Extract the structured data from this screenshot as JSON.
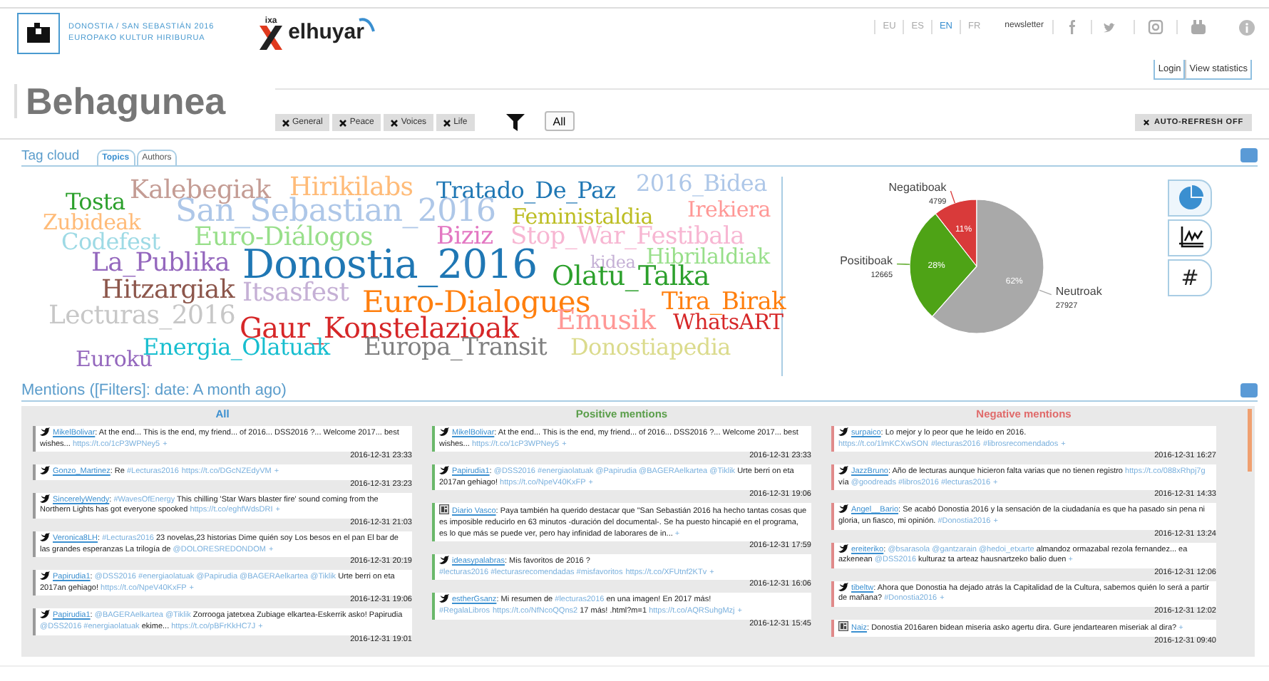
{
  "header": {
    "logo_lines": [
      "DONOSTIA / SAN SEBASTIÁN 2016",
      "EUROPAKO KULTUR HIRIBURUA"
    ],
    "partner_small": "ixa",
    "partner_name": "elhuyar",
    "languages": [
      {
        "label": "EU",
        "selected": false
      },
      {
        "label": "ES",
        "selected": false
      },
      {
        "label": "EN",
        "selected": true
      },
      {
        "label": "FR",
        "selected": false
      }
    ],
    "newsletter": "newsletter",
    "login": "Login",
    "view_statistics": "View statistics"
  },
  "title": "Behagunea",
  "filters": [
    "General",
    "Peace",
    "Voices",
    "Life"
  ],
  "all_button": "All",
  "auto_refresh": "AUTO-REFRESH OFF",
  "tag_cloud": {
    "title": "Tag cloud",
    "tabs": [
      {
        "label": "Topics",
        "selected": true
      },
      {
        "label": "Authors",
        "selected": false
      }
    ],
    "tags": [
      {
        "text": "Kalebegiak",
        "color": "#c49c94"
      },
      {
        "text": "Hirikilabs",
        "color": "#ffbb78"
      },
      {
        "text": "Tratado_De_Paz",
        "color": "#1f77b4"
      },
      {
        "text": "2016_Bidea",
        "color": "#aec7e8"
      },
      {
        "text": "Tosta",
        "color": "#2ca02c"
      },
      {
        "text": "Zubideak",
        "color": "#ffbb78"
      },
      {
        "text": "San_Sebastian_2016",
        "color": "#aec7e8"
      },
      {
        "text": "Feministaldia",
        "color": "#bcbd22"
      },
      {
        "text": "Irekiera",
        "color": "#ff9896"
      },
      {
        "text": "Codefest",
        "color": "#9edae5"
      },
      {
        "text": "Euro-Diálogos",
        "color": "#98df8a"
      },
      {
        "text": "Biziz",
        "color": "#e377c2"
      },
      {
        "text": "Stop_War_Festibala",
        "color": "#f7b6d2"
      },
      {
        "text": "La_Publika",
        "color": "#9467bd"
      },
      {
        "text": "Donostia_2016",
        "color": "#1f77b4"
      },
      {
        "text": "kidea",
        "color": "#c5b0d5"
      },
      {
        "text": "Hibrilaldiak",
        "color": "#98df8a"
      },
      {
        "text": "Olatu_Talka",
        "color": "#2ca02c"
      },
      {
        "text": "Hitzargiak",
        "color": "#8c564b"
      },
      {
        "text": "Itsasfest",
        "color": "#c5b0d5"
      },
      {
        "text": "Euro-Dialogues",
        "color": "#ff7f0e"
      },
      {
        "text": "Tira_Birak",
        "color": "#ff7f0e"
      },
      {
        "text": "Lecturas_2016",
        "color": "#c7c7c7"
      },
      {
        "text": "Gaur_Konstelazioak",
        "color": "#d62728"
      },
      {
        "text": "Emusik",
        "color": "#ff9896"
      },
      {
        "text": "WhatsART",
        "color": "#d62728"
      },
      {
        "text": "Euroku",
        "color": "#9467bd"
      },
      {
        "text": "Energia_Olatuak",
        "color": "#17becf"
      },
      {
        "text": "Europa_Transit",
        "color": "#7f7f7f"
      },
      {
        "text": "Donostiapedia",
        "color": "#dbdb8d"
      }
    ],
    "chart_data": {
      "type": "pie",
      "categories": [
        "Negatiboak",
        "Positiboak",
        "Neutroak"
      ],
      "values": [
        10.57,
        27.9,
        61.53
      ],
      "value_labels": [
        "11%",
        "28%",
        "62%"
      ]
    },
    "slice_counts": [
      "4799",
      "12665",
      "27927"
    ],
    "chart_views": [
      {
        "kind": "pie",
        "selected": true
      },
      {
        "kind": "line",
        "selected": false
      },
      {
        "kind": "hashtag",
        "label": "#",
        "selected": false
      }
    ]
  },
  "mentions": {
    "title": "Mentions ([Filters]: date: A month ago)",
    "columns": [
      {
        "kind": "all",
        "title": "All",
        "items": [
          {
            "kind": "tweet",
            "author": "MikelBolivar",
            "body": [
              {
                "kind": "text",
                "text": ": At the end... This is the end, my friend... of 2016... DSS2016 ?... Welcome 2017... best wishes... "
              },
              {
                "kind": "link",
                "text": "https://t.co/1cP3WPNey5"
              },
              {
                "kind": "link",
                "text": "+"
              }
            ],
            "date": "2016-12-31 23:33"
          },
          {
            "kind": "tweet",
            "author": "Gonzo_Martinez",
            "body": [
              {
                "kind": "text",
                "text": ": Re "
              },
              {
                "kind": "link",
                "text": "#Lecturas2016"
              },
              {
                "kind": "link",
                "text": "https://t.co/DGcNZEdyVM"
              },
              {
                "kind": "link",
                "text": "+"
              }
            ],
            "date": "2016-12-31 23:23"
          },
          {
            "kind": "tweet",
            "author": "SincerelyWendy",
            "body": [
              {
                "kind": "text",
                "text": ": "
              },
              {
                "kind": "link",
                "text": "#WavesOfEnergy"
              },
              {
                "kind": "text",
                "text": " This chilling 'Star Wars blaster fire' sound coming from the Northern Lights has got everyone spooked "
              },
              {
                "kind": "link",
                "text": "https://t.co/eghfWdsDRI"
              },
              {
                "kind": "link",
                "text": "+"
              }
            ],
            "date": "2016-12-31 21:03"
          },
          {
            "kind": "tweet",
            "author": "Veronica8LH",
            "body": [
              {
                "kind": "text",
                "text": ": "
              },
              {
                "kind": "link",
                "text": "#Lecturas2016"
              },
              {
                "kind": "text",
                "text": " 23 novelas,23 historias Dime quién soy Los besos en el pan El bar de las grandes esperanzas La trilogía de "
              },
              {
                "kind": "link",
                "text": "@DOLORESREDONDOM"
              },
              {
                "kind": "link",
                "text": "+"
              }
            ],
            "date": "2016-12-31 20:19"
          },
          {
            "kind": "tweet",
            "author": "Papirudia1",
            "body": [
              {
                "kind": "text",
                "text": ": "
              },
              {
                "kind": "link",
                "text": "@DSS2016 #energiaolatuak @Papirudia @BAGERAelkartea @Tiklik"
              },
              {
                "kind": "text",
                "text": " Urte berri on eta 2017an gehiago! "
              },
              {
                "kind": "link",
                "text": "https://t.co/NpeV40KxFP"
              },
              {
                "kind": "link",
                "text": "+"
              }
            ],
            "date": "2016-12-31 19:06"
          },
          {
            "kind": "tweet",
            "author": "Papirudia1",
            "body": [
              {
                "kind": "text",
                "text": ": "
              },
              {
                "kind": "link",
                "text": "@BAGERAelkartea @Tiklik"
              },
              {
                "kind": "text",
                "text": " Zorrooga jatetxea Zubiage elkartea-Eskerrik asko! Papirudia "
              },
              {
                "kind": "link",
                "text": "@DSS2016 #energiaolatuak"
              },
              {
                "kind": "text",
                "text": " ekime... "
              },
              {
                "kind": "link",
                "text": "https://t.co/pBFrKkHC7J"
              },
              {
                "kind": "link",
                "text": "+"
              }
            ],
            "date": "2016-12-31 19:01"
          }
        ]
      },
      {
        "kind": "positive",
        "title": "Positive mentions",
        "items": [
          {
            "kind": "tweet",
            "author": "MikelBolivar",
            "body": [
              {
                "kind": "text",
                "text": ": At the end... This is the end, my friend... of 2016... DSS2016 ?... Welcome 2017... best wishes... "
              },
              {
                "kind": "link",
                "text": "https://t.co/1cP3WPNey5"
              },
              {
                "kind": "link",
                "text": "+"
              }
            ],
            "date": "2016-12-31 23:33"
          },
          {
            "kind": "tweet",
            "author": "Papirudia1",
            "body": [
              {
                "kind": "text",
                "text": ": "
              },
              {
                "kind": "link",
                "text": "@DSS2016 #energiaolatuak @Papirudia @BAGERAelkartea @Tiklik"
              },
              {
                "kind": "text",
                "text": " Urte berri on eta 2017an gehiago! "
              },
              {
                "kind": "link",
                "text": "https://t.co/NpeV40KxFP"
              },
              {
                "kind": "link",
                "text": "+"
              }
            ],
            "date": "2016-12-31 19:06"
          },
          {
            "kind": "news",
            "author": "Diario Vasco",
            "body": [
              {
                "kind": "text",
                "text": ": Paya también ha querido destacar que \"San Sebastián 2016 ha hecho tantas cosas que es imposible reducirlo en 63 minutos -duración del documental-. Se ha puesto hincapié en el programa, es lo que más se puede ver, pero hay infinidad de laborares de in... "
              },
              {
                "kind": "link",
                "text": "+"
              }
            ],
            "date": "2016-12-31 17:59"
          },
          {
            "kind": "tweet",
            "author": "ideasypalabras",
            "body": [
              {
                "kind": "text",
                "text": ": Mis favoritos de 2016 ? "
              },
              {
                "kind": "link",
                "text": "#lecturas2016 #lecturasrecomendadas #misfavoritos"
              },
              {
                "kind": "link",
                "text": "https://t.co/XFUtnf2KTv"
              },
              {
                "kind": "link",
                "text": "+"
              }
            ],
            "date": "2016-12-31 16:06"
          },
          {
            "kind": "tweet",
            "author": "estherGsanz",
            "body": [
              {
                "kind": "text",
                "text": ": Mi resumen de "
              },
              {
                "kind": "link",
                "text": "#lecturas2016"
              },
              {
                "kind": "text",
                "text": " en una imagen! En 2017 más! "
              },
              {
                "kind": "link",
                "text": "#RegalaLibros"
              },
              {
                "kind": "link",
                "text": "https://t.co/NfNcoQQns2"
              },
              {
                "kind": "text",
                "text": " 17 más! .html?m=1 "
              },
              {
                "kind": "link",
                "text": "https://t.co/AQRSuhgMzj"
              },
              {
                "kind": "link",
                "text": "+"
              }
            ],
            "date": "2016-12-31 15:45"
          }
        ]
      },
      {
        "kind": "negative",
        "title": "Negative mentions",
        "items": [
          {
            "kind": "tweet",
            "author": "surpaico",
            "body": [
              {
                "kind": "text",
                "text": ": Lo mejor y lo peor que he leído en 2016. "
              },
              {
                "kind": "link",
                "text": "https://t.co/1lmKCXwSON"
              },
              {
                "kind": "link",
                "text": "#lecturas2016"
              },
              {
                "kind": "link",
                "text": "#librosrecomendados"
              },
              {
                "kind": "link",
                "text": "+"
              }
            ],
            "date": "2016-12-31 16:27"
          },
          {
            "kind": "tweet",
            "author": "JazzBruno",
            "body": [
              {
                "kind": "text",
                "text": ": Año de lecturas aunque hicieron falta varias que no tienen registro "
              },
              {
                "kind": "link",
                "text": "https://t.co/088xRhpj7g"
              },
              {
                "kind": "text",
                "text": " vía "
              },
              {
                "kind": "link",
                "text": "@goodreads #libros2016 #lecturas2016"
              },
              {
                "kind": "link",
                "text": "+"
              }
            ],
            "date": "2016-12-31 14:33"
          },
          {
            "kind": "tweet",
            "author": "Angel__Bario",
            "body": [
              {
                "kind": "text",
                "text": ": Se acabó Donostia 2016 y la sensación de la ciudadanía es que ha pasado sin pena ni gloria, un fiasco, mi opinión. "
              },
              {
                "kind": "link",
                "text": "#Donostia2016"
              },
              {
                "kind": "link",
                "text": "+"
              }
            ],
            "date": "2016-12-31 13:24"
          },
          {
            "kind": "tweet",
            "author": "ereiteriko",
            "body": [
              {
                "kind": "text",
                "text": ": "
              },
              {
                "kind": "link",
                "text": "@bsarasola @gantzarain @hedoi_etxarte"
              },
              {
                "kind": "text",
                "text": " almandoz ormazabal rezola fernandez... ea azkenean "
              },
              {
                "kind": "link",
                "text": "@DSS2016"
              },
              {
                "kind": "text",
                "text": " kulturaz ta arteaz hausnartzeko balio duen "
              },
              {
                "kind": "link",
                "text": "+"
              }
            ],
            "date": "2016-12-31 12:06"
          },
          {
            "kind": "tweet",
            "author": "tibeltw",
            "body": [
              {
                "kind": "text",
                "text": ": Ahora que Donostia ha dejado atrás la Capitalidad de la Cultura, sabemos quién lo será a partir de mañana? "
              },
              {
                "kind": "link",
                "text": "#Donostia2016"
              },
              {
                "kind": "link",
                "text": "+"
              }
            ],
            "date": "2016-12-31 12:02"
          },
          {
            "kind": "news",
            "author": "Naiz",
            "body": [
              {
                "kind": "text",
                "text": ": Donostia 2016aren bidean miseria asko agertu dira. Gure jendartearen miseriak al dira? "
              },
              {
                "kind": "link",
                "text": "+"
              }
            ],
            "date": "2016-12-31 09:40"
          }
        ]
      }
    ]
  }
}
